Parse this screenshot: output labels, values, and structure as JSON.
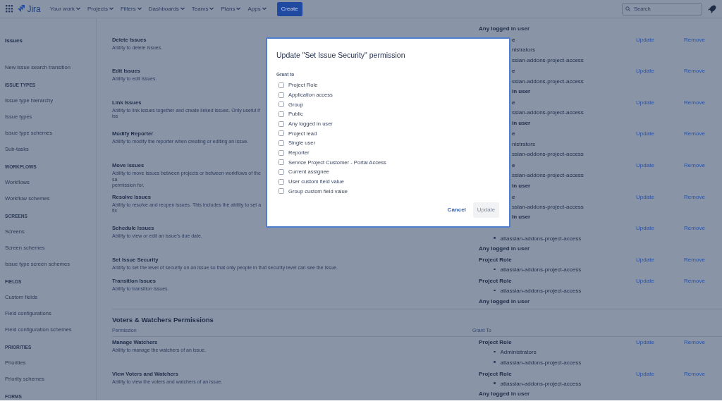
{
  "nav": {
    "logo": "Jira",
    "items": [
      {
        "label": "Your work"
      },
      {
        "label": "Projects"
      },
      {
        "label": "Filters"
      },
      {
        "label": "Dashboards"
      },
      {
        "label": "Teams"
      },
      {
        "label": "Plans"
      },
      {
        "label": "Apps"
      }
    ],
    "create": "Create",
    "search": {
      "placeholder": "Search"
    }
  },
  "sidebar": {
    "items": [
      {
        "kind": "title",
        "label": "Issues"
      },
      {
        "kind": "link",
        "label": "New issue search transition"
      },
      {
        "kind": "section",
        "label": "ISSUE TYPES"
      },
      {
        "kind": "link",
        "label": "Issue type hierarchy"
      },
      {
        "kind": "link",
        "label": "Issue types"
      },
      {
        "kind": "link",
        "label": "Issue type schemes"
      },
      {
        "kind": "link",
        "label": "Sub-tasks"
      },
      {
        "kind": "section",
        "label": "WORKFLOWS"
      },
      {
        "kind": "link",
        "label": "Workflows"
      },
      {
        "kind": "link",
        "label": "Workflow schemes"
      },
      {
        "kind": "section",
        "label": "SCREENS"
      },
      {
        "kind": "link",
        "label": "Screens"
      },
      {
        "kind": "link",
        "label": "Screen schemes"
      },
      {
        "kind": "link",
        "label": "Issue type screen schemes"
      },
      {
        "kind": "section",
        "label": "FIELDS"
      },
      {
        "kind": "link",
        "label": "Custom fields"
      },
      {
        "kind": "link",
        "label": "Field configurations"
      },
      {
        "kind": "link",
        "label": "Field configuration schemes"
      },
      {
        "kind": "section",
        "label": "PRIORITIES"
      },
      {
        "kind": "link",
        "label": "Priorities"
      },
      {
        "kind": "link",
        "label": "Priority schemes"
      },
      {
        "kind": "section",
        "label": "FORMS"
      }
    ]
  },
  "permissions": {
    "rows": [
      {
        "grants": [
          {
            "kind": "heading",
            "text": "Any logged in user"
          }
        ]
      },
      {
        "name": "Delete Issues",
        "description_lines": [
          "Ability to delete issues."
        ],
        "grants": [
          {
            "kind": "heading_cut",
            "text": "e"
          },
          {
            "kind": "member_cut",
            "text": "nistrators"
          },
          {
            "kind": "member_cut",
            "text": "ssian-addons-project-access"
          }
        ],
        "actions": [
          "Update",
          "Remove"
        ]
      },
      {
        "name": "Edit Issues",
        "description_lines": [
          "Ability to edit issues."
        ],
        "grants": [
          {
            "kind": "heading_cut",
            "text": "e"
          },
          {
            "kind": "member_cut",
            "text": "ssian-addons-project-access"
          },
          {
            "kind": "heading_cut",
            "text": "in user"
          }
        ],
        "actions": [
          "Update",
          "Remove"
        ]
      },
      {
        "name": "Link Issues",
        "description_lines": [
          "Ability to link issues together and create linked issues. Only useful if iss"
        ],
        "grants": [
          {
            "kind": "heading_cut",
            "text": "e"
          },
          {
            "kind": "member_cut",
            "text": "ssian-addons-project-access"
          },
          {
            "kind": "heading_cut",
            "text": "in user"
          }
        ],
        "actions": [
          "Update",
          "Remove"
        ]
      },
      {
        "name": "Modify Reporter",
        "description_lines": [
          "Ability to modify the reporter when creating or editing an issue."
        ],
        "grants": [
          {
            "kind": "heading_cut",
            "text": "e"
          },
          {
            "kind": "member_cut",
            "text": "nistrators"
          },
          {
            "kind": "member_cut",
            "text": "ssian-addons-project-access"
          }
        ],
        "actions": [
          "Update",
          "Remove"
        ]
      },
      {
        "name": "Move Issues",
        "description_lines": [
          "Ability to move issues between projects or between workflows of the sa",
          "permission for."
        ],
        "grants": [
          {
            "kind": "heading_cut",
            "text": "e"
          },
          {
            "kind": "member_cut",
            "text": "ssian-addons-project-access"
          },
          {
            "kind": "heading_cut",
            "text": "in user"
          }
        ],
        "actions": [
          "Update",
          "Remove"
        ]
      },
      {
        "name": "Resolve Issues",
        "description_lines": [
          "Ability to resolve and reopen issues. This includes the ability to set a fix"
        ],
        "grants": [
          {
            "kind": "heading_cut",
            "text": "e"
          },
          {
            "kind": "member_cut",
            "text": "ssian-addons-project-access"
          },
          {
            "kind": "heading_cut",
            "text": "in user"
          }
        ],
        "actions": [
          "Update",
          "Remove"
        ]
      },
      {
        "name": "Schedule Issues",
        "description_lines": [
          "Ability to view or edit an issue's due date."
        ],
        "grants": [
          {
            "kind": "gap"
          },
          {
            "kind": "member",
            "text": "atlassian-addons-project-access"
          },
          {
            "kind": "heading",
            "text": "Any logged in user"
          }
        ],
        "actions": [
          "Update",
          "Remove"
        ]
      },
      {
        "name": "Set Issue Security",
        "description_lines": [
          "Ability to set the level of security on an issue so that only people in that security level can see the issue."
        ],
        "grants": [
          {
            "kind": "heading",
            "text": "Project Role"
          },
          {
            "kind": "member",
            "text": "atlassian-addons-project-access"
          }
        ],
        "actions": [
          "Update",
          "Remove"
        ]
      },
      {
        "name": "Transition Issues",
        "description_lines": [
          "Ability to transition issues."
        ],
        "grants": [
          {
            "kind": "heading",
            "text": "Project Role"
          },
          {
            "kind": "member",
            "text": "atlassian-addons-project-access"
          },
          {
            "kind": "heading",
            "text": "Any logged in user"
          }
        ],
        "actions": [
          "Update",
          "Remove"
        ]
      }
    ]
  },
  "voters": {
    "title": "Voters & Watchers Permissions",
    "columns": [
      "Permission",
      "Grant To"
    ],
    "rows": [
      {
        "name": "Manage Watchers",
        "description_lines": [
          "Ability to manage the watchers of an issue."
        ],
        "grants": [
          {
            "kind": "heading",
            "text": "Project Role"
          },
          {
            "kind": "member",
            "text": "Administrators"
          },
          {
            "kind": "member",
            "text": "atlassian-addons-project-access"
          }
        ],
        "actions": [
          "Update",
          "Remove"
        ]
      },
      {
        "name": "View Voters and Watchers",
        "description_lines": [
          "Ability to view the voters and watchers of an issue."
        ],
        "grants": [
          {
            "kind": "heading",
            "text": "Project Role"
          },
          {
            "kind": "member",
            "text": "atlassian-addons-project-access"
          },
          {
            "kind": "heading",
            "text": "Any logged in user"
          }
        ],
        "actions": [
          "Update",
          "Remove"
        ]
      }
    ]
  },
  "dialog": {
    "title": "Update \"Set Issue Security\" permission",
    "label": "Grant to",
    "options": [
      {
        "label": "Project Role",
        "checked": false
      },
      {
        "label": "Application access",
        "checked": false
      },
      {
        "label": "Group",
        "checked": false
      },
      {
        "label": "Public",
        "checked": false
      },
      {
        "label": "Any logged in user",
        "checked": false
      },
      {
        "label": "Project lead",
        "checked": false
      },
      {
        "label": "Single user",
        "checked": false
      },
      {
        "label": "Reporter",
        "checked": false
      },
      {
        "label": "Service Project Customer - Portal Access",
        "checked": false
      },
      {
        "label": "Current assignee",
        "checked": false
      },
      {
        "label": "User custom field value",
        "checked": false
      },
      {
        "label": "Group custom field value",
        "checked": false
      }
    ],
    "cancel": "Cancel",
    "submit": {
      "label": "Update",
      "disabled": true
    }
  }
}
